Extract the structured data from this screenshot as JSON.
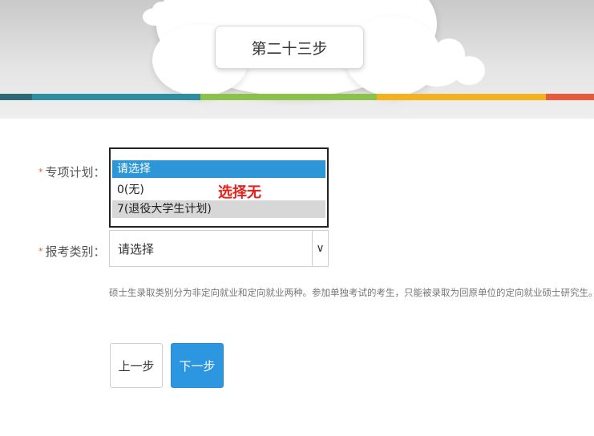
{
  "banner": {
    "step_title": "第二十三步",
    "stripe_colors": [
      "#2b6a73",
      "#2c8ea1",
      "#8bc34a",
      "#f4b31c",
      "#e85a3a"
    ]
  },
  "form": {
    "special_plan": {
      "label": "专项计划：",
      "options": [
        "请选择",
        "0(无)",
        "7(退役大学生计划)"
      ],
      "selected_index": 0,
      "annotation": "选择无"
    },
    "exam_category": {
      "label": "报考类别：",
      "value": "请选择",
      "arrow": "∨"
    },
    "note": "硕士生录取类别分为非定向就业和定向就业两种。参加单独考试的考生，只能被录取为回原单位的定向就业硕士研究生。"
  },
  "buttons": {
    "prev": "上一步",
    "next": "下一步"
  },
  "colors": {
    "accent": "#2d96e0",
    "required_star": "#e05a2a",
    "annotation": "#e8201c"
  }
}
